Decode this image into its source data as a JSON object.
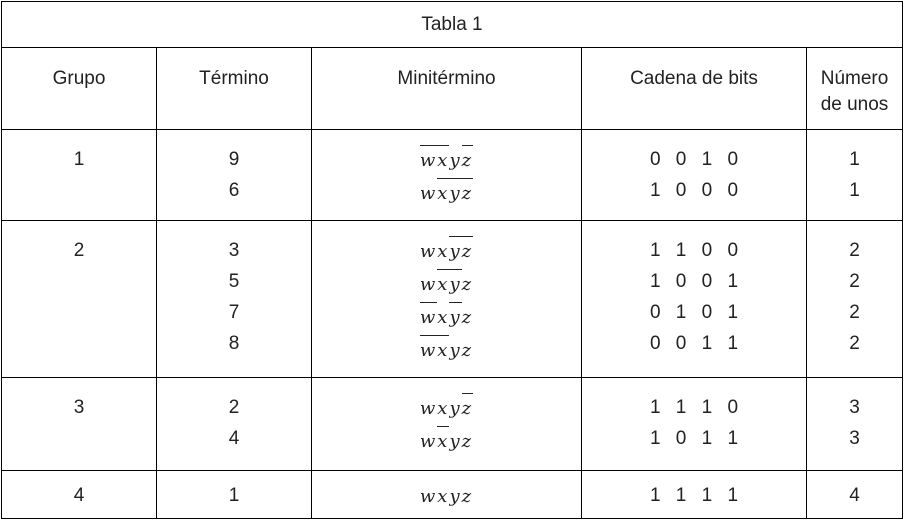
{
  "title": "Tabla 1",
  "headers": {
    "grupo": "Grupo",
    "termino": "Término",
    "minitermino": "Minitérmino",
    "cadena": "Cadena de bits",
    "numero_line1": "Número",
    "numero_line2": "de unos"
  },
  "groups": [
    {
      "grupo": "1",
      "rows": [
        {
          "termino": "9",
          "vars": [
            [
              "w",
              true
            ],
            [
              "x",
              true
            ],
            [
              "y",
              false
            ],
            [
              "z",
              true
            ]
          ],
          "bits": "0 0 1 0",
          "unos": "1"
        },
        {
          "termino": "6",
          "vars": [
            [
              "w",
              false
            ],
            [
              "x",
              true
            ],
            [
              "y",
              true
            ],
            [
              "z",
              true
            ]
          ],
          "bits": "1 0 0 0",
          "unos": "1"
        }
      ]
    },
    {
      "grupo": "2",
      "rows": [
        {
          "termino": "3",
          "vars": [
            [
              "w",
              false
            ],
            [
              "x",
              false
            ],
            [
              "y",
              true
            ],
            [
              "z",
              true
            ]
          ],
          "bits": "1 1 0 0",
          "unos": "2"
        },
        {
          "termino": "5",
          "vars": [
            [
              "w",
              false
            ],
            [
              "x",
              true
            ],
            [
              "y",
              true
            ],
            [
              "z",
              false
            ]
          ],
          "bits": "1 0 0 1",
          "unos": "2"
        },
        {
          "termino": "7",
          "vars": [
            [
              "w",
              true
            ],
            [
              "x",
              false
            ],
            [
              "y",
              true
            ],
            [
              "z",
              false
            ]
          ],
          "bits": "0 1 0 1",
          "unos": "2"
        },
        {
          "termino": "8",
          "vars": [
            [
              "w",
              true
            ],
            [
              "x",
              true
            ],
            [
              "y",
              false
            ],
            [
              "z",
              false
            ]
          ],
          "bits": "0 0 1 1",
          "unos": "2"
        }
      ]
    },
    {
      "grupo": "3",
      "rows": [
        {
          "termino": "2",
          "vars": [
            [
              "w",
              false
            ],
            [
              "x",
              false
            ],
            [
              "y",
              false
            ],
            [
              "z",
              true
            ]
          ],
          "bits": "1 1 1 0",
          "unos": "3"
        },
        {
          "termino": "4",
          "vars": [
            [
              "w",
              false
            ],
            [
              "x",
              true
            ],
            [
              "y",
              false
            ],
            [
              "z",
              false
            ]
          ],
          "bits": "1 0 1 1",
          "unos": "3"
        }
      ]
    },
    {
      "grupo": "4",
      "rows": [
        {
          "termino": "1",
          "vars": [
            [
              "w",
              false
            ],
            [
              "x",
              false
            ],
            [
              "y",
              false
            ],
            [
              "z",
              false
            ]
          ],
          "bits": "1 1 1 1",
          "unos": "4"
        }
      ]
    }
  ]
}
